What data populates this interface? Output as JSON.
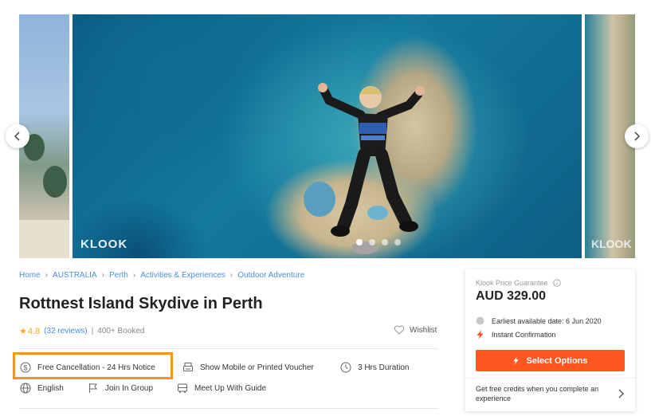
{
  "gallery": {
    "watermark": "KLOOK",
    "watermark_right": "KLOOK",
    "slide_count": 4,
    "active_slide": 1
  },
  "breadcrumb": {
    "items": [
      "Home",
      "AUSTRALIA",
      "Perth",
      "Activities & Experiences",
      "Outdoor Adventure"
    ]
  },
  "activity": {
    "title": "Rottnest Island Skydive in Perth",
    "rating": "4.8",
    "reviews": "(32 reviews)",
    "separator": "|",
    "booked": "400+ Booked",
    "wishlist": "Wishlist"
  },
  "features": {
    "cancellation": "Free Cancellation - 24 Hrs Notice",
    "voucher": "Show Mobile or Printed Voucher",
    "duration": "3 Hrs Duration",
    "language": "English",
    "group": "Join In Group",
    "meetup": "Meet Up With Guide"
  },
  "booking": {
    "guarantee": "Klook Price Guarantee",
    "price": "AUD 329.00",
    "earliest_date": "Earliest available date: 6 Jun 2020",
    "confirmation": "Instant Confirmation",
    "select_button": "Select Options",
    "credits_text": "Get free credits when you complete an experience"
  },
  "colors": {
    "accent": "#ff5722",
    "link": "#4a8fd6",
    "star": "#ffa628",
    "highlight_border": "#f7941d"
  },
  "icons": [
    "chevron-left-icon",
    "chevron-right-icon",
    "star-icon",
    "heart-icon",
    "dollar-icon",
    "printer-icon",
    "clock-icon",
    "globe-icon",
    "flag-icon",
    "bus-icon",
    "info-icon",
    "calendar-icon",
    "bolt-icon"
  ]
}
